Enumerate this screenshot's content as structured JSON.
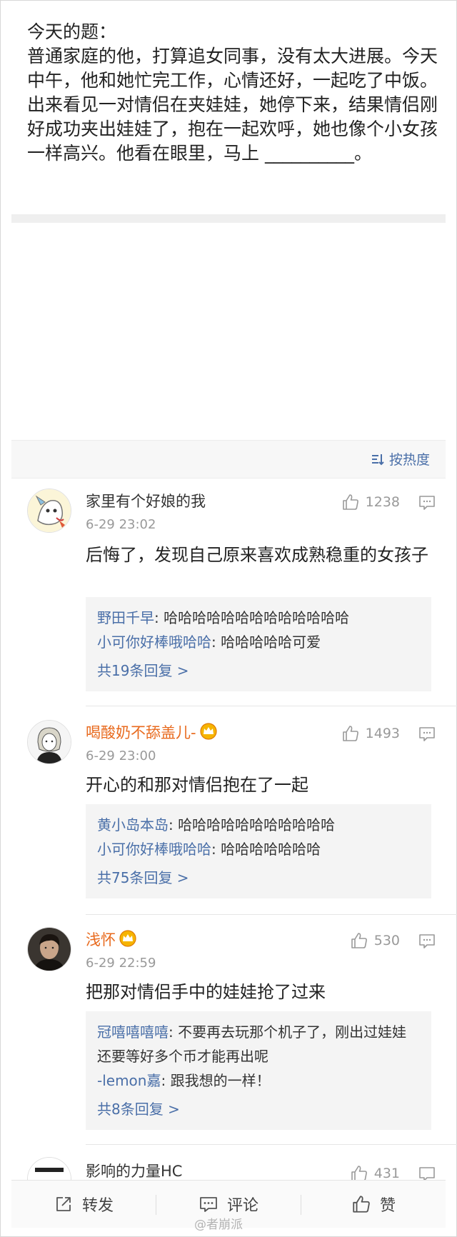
{
  "post": {
    "text": "今天的题：\n普通家庭的他，打算追女同事，没有太大进展。今天中午，他和她忙完工作，心情还好，一起吃了中饭。出来看见一对情侣在夹娃娃，她停下来，结果情侣刚好成功夹出娃娃了，抱在一起欢呼，她也像个小女孩一样高兴。他看在眼里，马上 __________。"
  },
  "sort": {
    "label": "按热度",
    "icon": "sort-icon"
  },
  "comments": [
    {
      "user": "家里有个好娘的我",
      "time": "6-29 23:02",
      "likes": "1238",
      "text": "后悔了，发现自己原来喜欢成熟稳重的女孩子",
      "replies": [
        {
          "user": "野田千早",
          "text": ": 哈哈哈哈哈哈哈哈哈哈哈哈哈"
        },
        {
          "user": "小可你好棒哦哈哈",
          "text": ": 哈哈哈哈哈可爱"
        }
      ],
      "more": "共19条回复 >"
    },
    {
      "user": "喝酸奶不舔盖儿-",
      "time": "6-29 23:00",
      "likes": "1493",
      "text": "开心的和那对情侣抱在了一起",
      "replies": [
        {
          "user": "黄小岛本岛",
          "text": ": 哈哈哈哈哈哈哈哈哈哈哈"
        },
        {
          "user": "小可你好棒哦哈哈",
          "text": ": 哈哈哈哈哈哈哈"
        }
      ],
      "more": "共75条回复 >"
    },
    {
      "user": "浅怀",
      "time": "6-29 22:59",
      "likes": "530",
      "text": "把那对情侣手中的娃娃抢了过来",
      "replies": [
        {
          "user": "冠嘻嘻嘻嘻",
          "text": ": 不要再去玩那个机子了，刚出过娃娃还要等好多个币才能再出呢"
        },
        {
          "user": "-lemon嘉",
          "text": ": 跟我想的一样！"
        }
      ],
      "more": "共8条回复 >"
    },
    {
      "user": "影响的力量HC",
      "likes": "431"
    }
  ],
  "actions": {
    "repost": "转发",
    "comment": "评论",
    "like": "赞"
  },
  "watermark": "@者崩派",
  "colors": {
    "link_blue": "#4a6fa8",
    "vip_orange": "#e86a1e",
    "reply_bg": "#f4f4f4"
  }
}
